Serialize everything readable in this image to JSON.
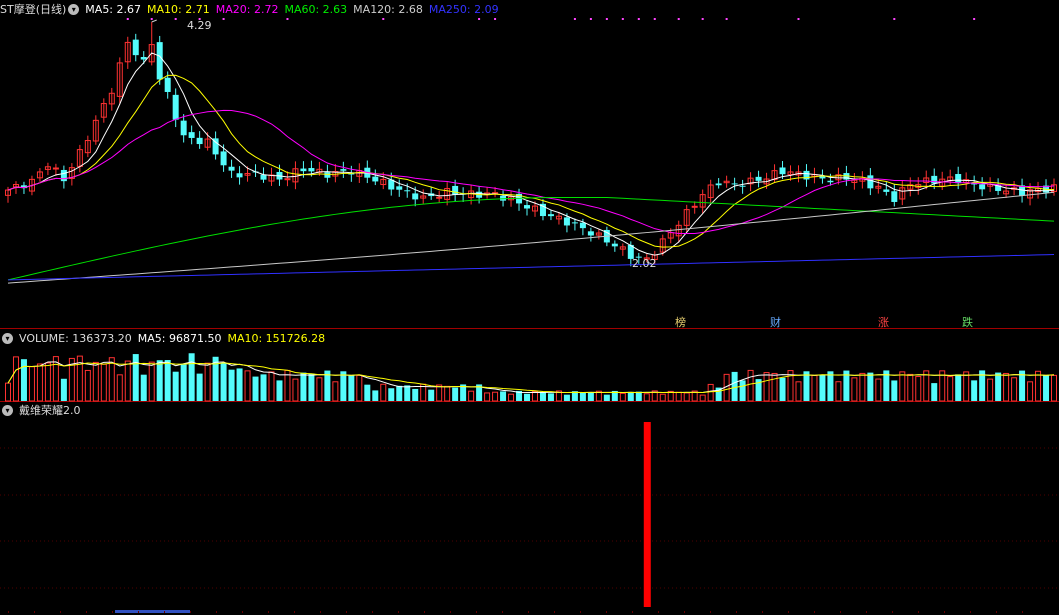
{
  "main_header": {
    "title": "ST摩登(日线)",
    "ma5": "MA5: 2.67",
    "ma10": "MA10: 2.71",
    "ma20": "MA20: 2.72",
    "ma60": "MA60: 2.63",
    "ma120": "MA120: 2.68",
    "ma250": "MA250: 2.09"
  },
  "volume_header": {
    "volume": "VOLUME: 136373.20",
    "ma5": "MA5: 96871.50",
    "ma10": "MA10: 151726.28"
  },
  "indicator_header": {
    "title": "戴维荣耀2.0"
  },
  "price_labels": {
    "high": "4.29",
    "low": "2.02"
  },
  "flags": [
    {
      "text": "榜",
      "color": "#e8d070"
    },
    {
      "text": "财",
      "color": "#66aaff"
    },
    {
      "text": "涨",
      "color": "#ff4444"
    },
    {
      "text": "跌",
      "color": "#66dd66"
    }
  ],
  "colors": {
    "up": "#ff3232",
    "down": "#54fcfc",
    "ma5": "#ffffff",
    "ma10": "#ffff00",
    "ma20": "#ff00ff",
    "ma60": "#00e000",
    "ma120": "#c8c8c8",
    "ma250": "#3030ff",
    "signal": "#ff0000",
    "divider": "#a00000"
  },
  "chart_data": {
    "type": "candlestick",
    "price_range": [
      1.8,
      4.45
    ],
    "high": 4.29,
    "low": 2.02,
    "signal_index": 80
  }
}
